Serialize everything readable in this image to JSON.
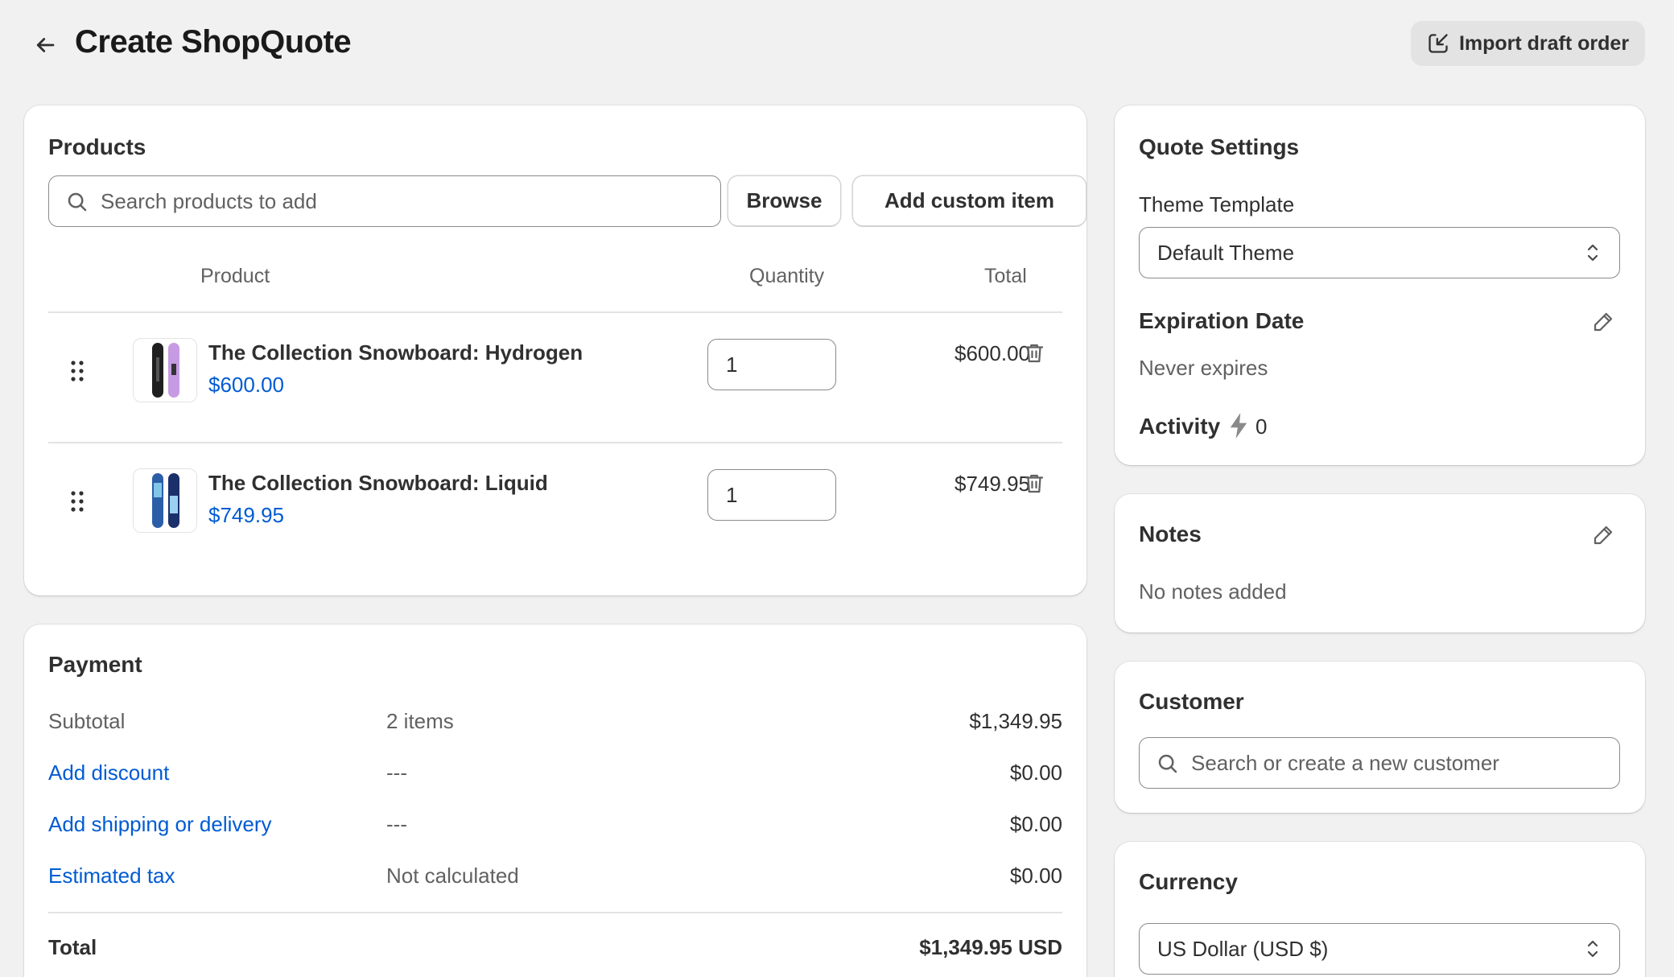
{
  "header": {
    "title": "Create ShopQuote",
    "import_label": "Import draft order"
  },
  "products": {
    "title": "Products",
    "search_placeholder": "Search products to add",
    "browse_label": "Browse",
    "add_custom_label": "Add custom item",
    "columns": {
      "product": "Product",
      "quantity": "Quantity",
      "total": "Total"
    },
    "items": [
      {
        "name": "The Collection Snowboard: Hydrogen",
        "price": "$600.00",
        "quantity": "1",
        "total": "$600.00"
      },
      {
        "name": "The Collection Snowboard: Liquid",
        "price": "$749.95",
        "quantity": "1",
        "total": "$749.95"
      }
    ]
  },
  "payment": {
    "title": "Payment",
    "rows": [
      {
        "label": "Subtotal",
        "detail": "2 items",
        "amount": "$1,349.95"
      },
      {
        "label": "Add discount",
        "detail": "---",
        "amount": "$0.00"
      },
      {
        "label": "Add shipping or delivery",
        "detail": "---",
        "amount": "$0.00"
      },
      {
        "label": "Estimated tax",
        "detail": "Not calculated",
        "amount": "$0.00"
      }
    ],
    "total_label": "Total",
    "total_amount": "$1,349.95 USD"
  },
  "quote_settings": {
    "title": "Quote Settings",
    "theme_label": "Theme Template",
    "theme_value": "Default Theme",
    "expiration_label": "Expiration Date",
    "expiration_value": "Never expires",
    "activity_label": "Activity",
    "activity_count": "0"
  },
  "notes": {
    "title": "Notes",
    "value": "No notes added"
  },
  "customer": {
    "title": "Customer",
    "search_placeholder": "Search or create a new customer"
  },
  "currency": {
    "title": "Currency",
    "value": "US Dollar (USD $)"
  },
  "colors": {
    "link": "#005bd3",
    "background": "#f1f1f1",
    "card": "#ffffff"
  }
}
